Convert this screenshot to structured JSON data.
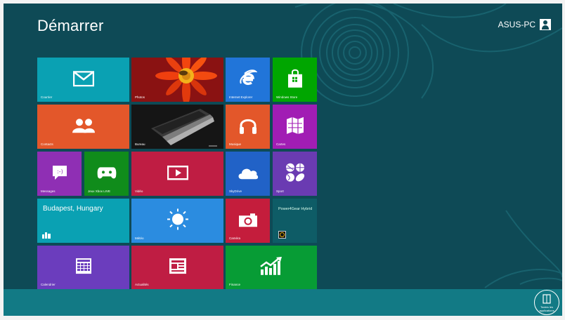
{
  "start": {
    "title": "Démarrer",
    "user_name": "ASUS-PC"
  },
  "tiles": {
    "courrier": "Courrier",
    "photos": "Photos",
    "internet_explorer": "Internet Explorer",
    "windows_store": "Windows Store",
    "contacts": "Contacts",
    "bureau": "Bureau",
    "musique": "Musique",
    "cartes": "Cartes",
    "messages": "Messages",
    "xbox": "Jeux Xbox LIVE",
    "video": "Vidéo",
    "skydrive": "SkyDrive",
    "sport": "Sport",
    "city": "Budapest, Hungary",
    "meteo": "Météo",
    "camera": "Caméra",
    "power4gear": "Power4Gear Hybrid",
    "calendrier": "Calendrier",
    "actualites": "Actualités",
    "finance": "Finance"
  },
  "all_apps": {
    "label": "Toutes les applications"
  },
  "colors": {
    "background": "#0e4a56",
    "bottom_bar": "#127a85",
    "teal": "#0aa1b3",
    "orange": "#e3572a",
    "blue": "#2175d9",
    "green": "#00a600",
    "purple": "#a11db4",
    "red": "#bf1d43"
  },
  "icons": {
    "courrier": "mail-icon",
    "internet_explorer": "internet-explorer-icon",
    "windows_store": "store-bag-icon",
    "contacts": "people-icon",
    "musique": "headphones-icon",
    "cartes": "map-icon",
    "messages": "chat-icon",
    "xbox": "gamepad-icon",
    "video": "video-play-icon",
    "skydrive": "cloud-icon",
    "sport": "sports-balls-icon",
    "meteo": "sun-icon",
    "camera": "camera-icon",
    "calendrier": "calendar-icon",
    "actualites": "newspaper-icon",
    "finance": "chart-up-icon"
  }
}
